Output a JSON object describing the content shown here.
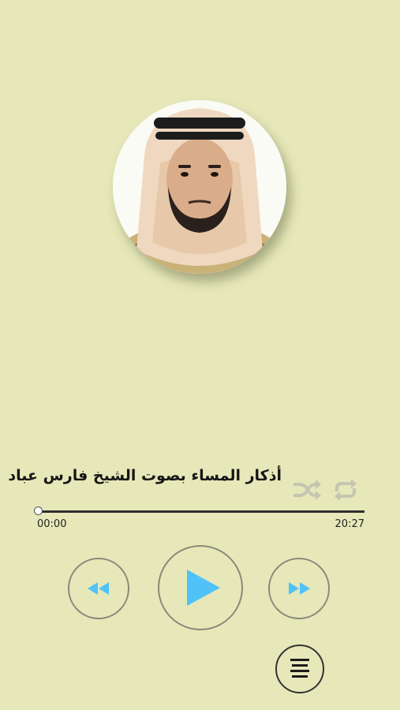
{
  "player": {
    "track_title": "أذكار المساء بصوت الشيخ فارس عباد",
    "current_time": "00:00",
    "total_time": "20:27",
    "progress": 0
  },
  "icons": {
    "avatar": "reciter-portrait",
    "shuffle": "shuffle-icon",
    "repeat": "repeat-icon",
    "rewind": "rewind-icon",
    "play": "play-icon",
    "forward": "fast-forward-icon",
    "playlist": "playlist-menu-icon"
  },
  "colors": {
    "background": "#e6e8b9",
    "accent": "#4fc3f7",
    "inactive_icon": "#c4c6b0"
  }
}
